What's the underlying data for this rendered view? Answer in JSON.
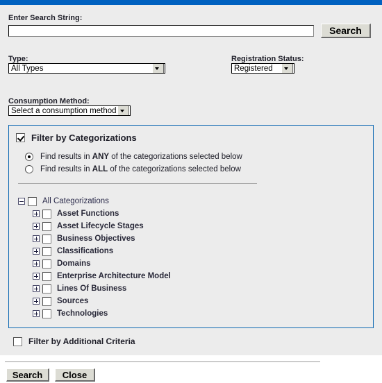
{
  "theme": {
    "accent_blue": "#0061c0",
    "panel_border_blue": "#0b67b2",
    "page_background": "#ececec",
    "button_face": "#dcdcd4"
  },
  "search": {
    "label": "Enter Search String:",
    "value": "",
    "placeholder": "",
    "button_label": "Search"
  },
  "type": {
    "label": "Type:",
    "selected": "All Types"
  },
  "registration_status": {
    "label": "Registration Status:",
    "selected": "Registered"
  },
  "consumption_method": {
    "label": "Consumption Method:",
    "selected": "Select a consumption method"
  },
  "categorizations": {
    "header_label": "Filter by Categorizations",
    "header_checked": true,
    "match_mode": "ANY",
    "radios": [
      {
        "id": "any",
        "prefix": "Find results in ",
        "emphasis": "ANY",
        "suffix": " of the categorizations selected below",
        "selected": true
      },
      {
        "id": "all",
        "prefix": "Find results in ",
        "emphasis": "ALL",
        "suffix": " of the categorizations selected below",
        "selected": false
      }
    ],
    "tree": {
      "root": {
        "label": "All Categorizations",
        "expander": "minus",
        "checked": false
      },
      "children": [
        {
          "label": "Asset Functions",
          "expander": "plus",
          "checked": false
        },
        {
          "label": "Asset Lifecycle Stages",
          "expander": "plus",
          "checked": false
        },
        {
          "label": "Business Objectives",
          "expander": "plus",
          "checked": false
        },
        {
          "label": "Classifications",
          "expander": "plus",
          "checked": false
        },
        {
          "label": "Domains",
          "expander": "plus",
          "checked": false
        },
        {
          "label": "Enterprise Architecture Model",
          "expander": "plus",
          "checked": false
        },
        {
          "label": "Lines Of Business",
          "expander": "plus",
          "checked": false
        },
        {
          "label": "Sources",
          "expander": "plus",
          "checked": false
        },
        {
          "label": "Technologies",
          "expander": "plus",
          "checked": false
        }
      ]
    }
  },
  "additional_criteria": {
    "label": "Filter by Additional Criteria",
    "checked": false
  },
  "footer": {
    "search_label": "Search",
    "close_label": "Close"
  }
}
